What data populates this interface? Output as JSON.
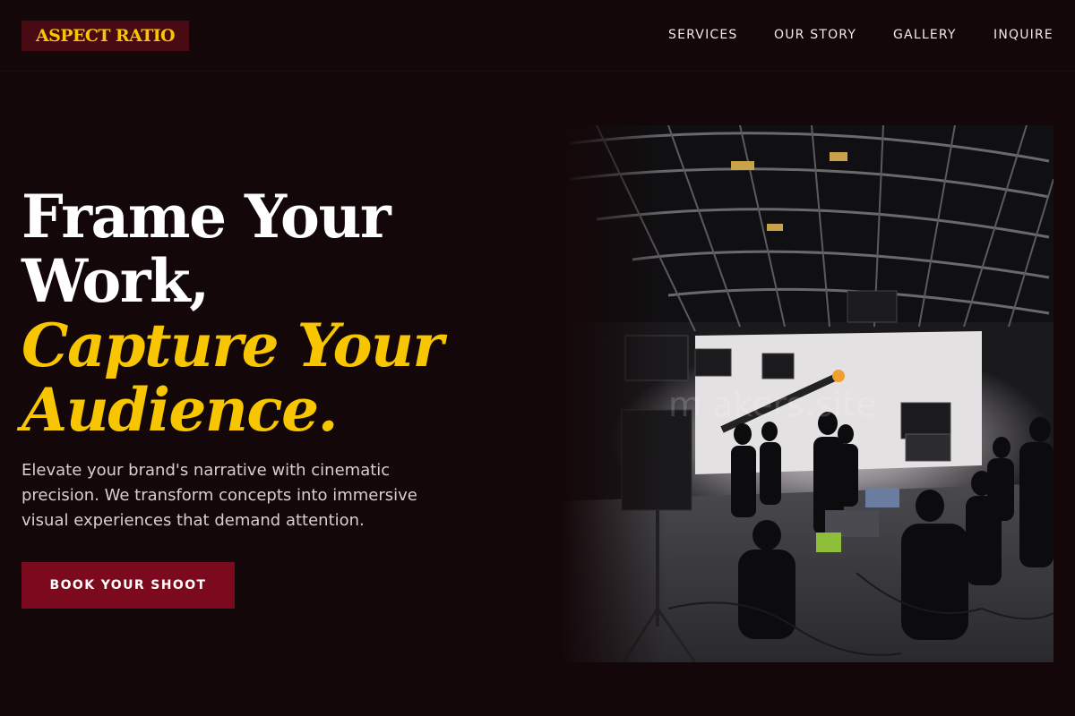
{
  "brand": {
    "name": "ASPECT RATIO"
  },
  "nav": {
    "items": [
      {
        "label": "SERVICES"
      },
      {
        "label": "OUR STORY"
      },
      {
        "label": "GALLERY"
      },
      {
        "label": "INQUIRE"
      }
    ]
  },
  "hero": {
    "headline_line1": "Frame Your",
    "headline_line2": "Work,",
    "headline_line3": "Capture Your",
    "headline_line4": "Audience.",
    "description": "Elevate your brand's narrative with cinematic precision. We transform concepts into immersive visual experiences that demand attention.",
    "cta_label": "BOOK YOUR SHOOT",
    "image_watermark": "m   akers.site"
  },
  "colors": {
    "background": "#140709",
    "accent_yellow": "#f7c600",
    "brand_crimson": "#7c0a1f",
    "logo_bg": "#4a0a14"
  }
}
